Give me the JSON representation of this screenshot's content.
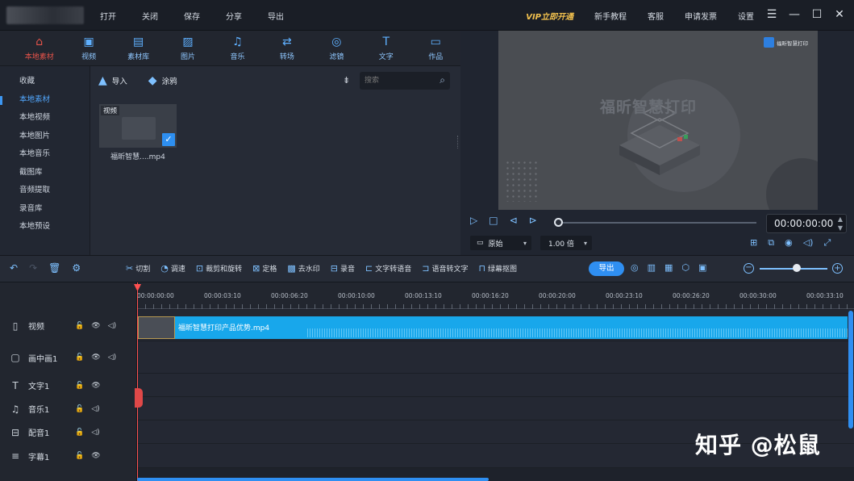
{
  "menu": [
    "打开",
    "关闭",
    "保存",
    "分享",
    "导出"
  ],
  "right_menu": {
    "vip": "VIP立即开通",
    "tutorial": "新手教程",
    "service": "客服",
    "invoice": "申请发票",
    "settings": "设置"
  },
  "window_controls": {
    "menu": "☰",
    "minimize": "—",
    "maximize": "☐",
    "close": "✕"
  },
  "media_tabs": [
    {
      "label": "本地素材",
      "icon": "⌂"
    },
    {
      "label": "视频",
      "icon": "▣"
    },
    {
      "label": "素材库",
      "icon": "▤"
    },
    {
      "label": "图片",
      "icon": "▨"
    },
    {
      "label": "音乐",
      "icon": "♫"
    },
    {
      "label": "转场",
      "icon": "⇄"
    },
    {
      "label": "滤镜",
      "icon": "◎"
    },
    {
      "label": "文字",
      "icon": "T"
    },
    {
      "label": "作品",
      "icon": "▭"
    }
  ],
  "sidebar": [
    "收藏",
    "本地素材",
    "本地视频",
    "本地图片",
    "本地音乐",
    "截图库",
    "音频提取",
    "录音库",
    "本地预设"
  ],
  "toolbar": {
    "import_label": "导入",
    "import_icon": "▲",
    "doodle_label": "涂鸦",
    "doodle_icon": "◆",
    "sort_icon": "⇟",
    "search_placeholder": "搜索",
    "search_icon": "⌕"
  },
  "media_item": {
    "tag": "视频",
    "name": "福昕智慧....mp4",
    "check": "✓"
  },
  "preview": {
    "watermark": "福昕智慧打印",
    "brand": "福昕智慧打印",
    "timecode": "00:00:00:00",
    "spin_up": "▲",
    "spin_down": "▼",
    "ratio": "原始",
    "ratio_icon": "▭",
    "speed": "1.00 倍",
    "dropdown": "▾",
    "play_controls": [
      "▷",
      "□",
      "⊲",
      "⊳"
    ],
    "right_icons": [
      "⊞",
      "⧉",
      "◉",
      "◁)",
      "⤢"
    ]
  },
  "edit_left": [
    "↶",
    "↷",
    "🗑",
    "⚙"
  ],
  "edit_tools": [
    {
      "label": "切割",
      "icon": "✂"
    },
    {
      "label": "调速",
      "icon": "◔"
    },
    {
      "label": "裁剪和旋转",
      "icon": "⊡"
    },
    {
      "label": "定格",
      "icon": "⊠"
    },
    {
      "label": "去水印",
      "icon": "▩"
    },
    {
      "label": "录音",
      "icon": "⊟"
    },
    {
      "label": "文字转语音",
      "icon": "⊏"
    },
    {
      "label": "语音转文字",
      "icon": "⊐"
    },
    {
      "label": "绿幕抠图",
      "icon": "⊓"
    }
  ],
  "export_label": "导出",
  "edit_right": [
    "◎",
    "▥",
    "▦",
    "⬡",
    "▣"
  ],
  "zoom": {
    "minus": "−",
    "plus": "+",
    "level": 0.55
  },
  "ruler_ticks": [
    "00:00:00:00",
    "00:00:03:10",
    "00:00:06:20",
    "00:00:10:00",
    "00:00:13:10",
    "00:00:16:20",
    "00:00:20:00",
    "00:00:23:10",
    "00:00:26:20",
    "00:00:30:00",
    "00:00:33:10"
  ],
  "tracks": [
    {
      "name": "视频",
      "icon": "▯",
      "controls": [
        "🔓",
        "👁",
        "◁)"
      ]
    },
    {
      "name": "画中画1",
      "icon": "▢",
      "controls": [
        "🔓",
        "👁",
        "◁)"
      ]
    },
    {
      "name": "文字1",
      "icon": "T",
      "controls": [
        "🔓",
        "👁"
      ]
    },
    {
      "name": "音乐1",
      "icon": "♫",
      "controls": [
        "🔓",
        "◁)"
      ]
    },
    {
      "name": "配音1",
      "icon": "⊟",
      "controls": [
        "🔓",
        "◁)"
      ]
    },
    {
      "name": "字幕1",
      "icon": "≡",
      "controls": [
        "🔓",
        "👁"
      ]
    }
  ],
  "clip": {
    "name": "福昕智慧打印产品优势.mp4"
  },
  "watermark_text": "知乎 @松鼠"
}
